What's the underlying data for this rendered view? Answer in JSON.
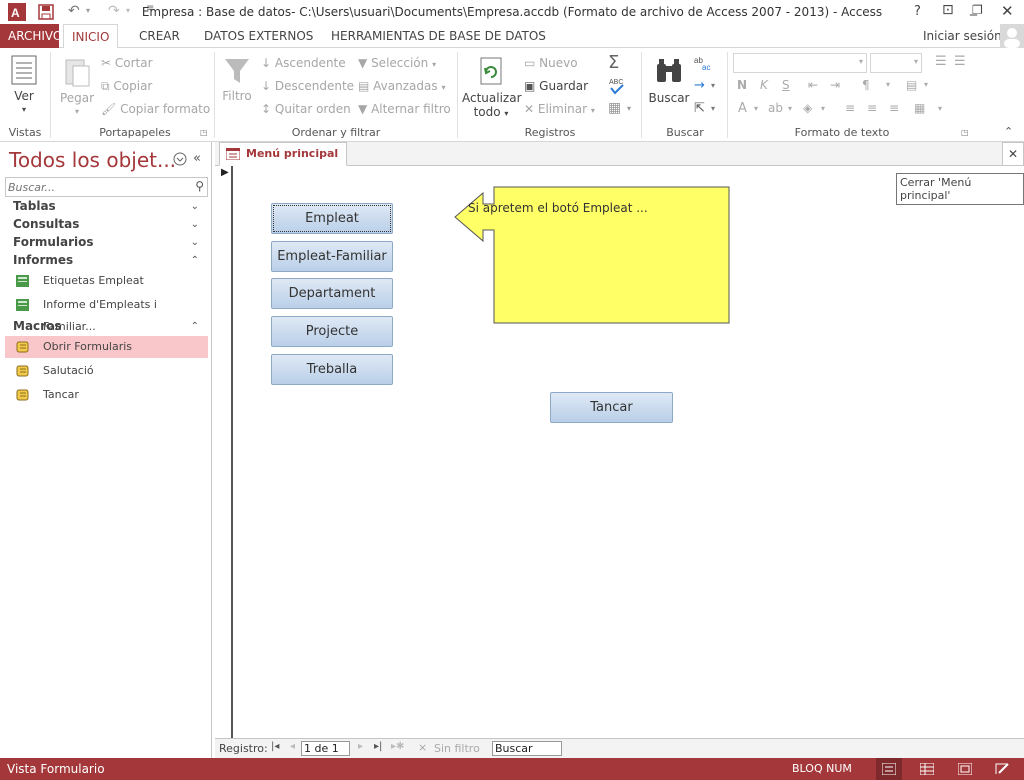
{
  "window": {
    "title": "Empresa : Base de datos- C:\\Users\\usuari\\Documents\\Empresa.accdb (Formato de archivo de Access 2007 - 2013) - Access",
    "help": "?",
    "app_icon": "access-logo"
  },
  "ribbon_tabs": {
    "file": "ARCHIVO",
    "home": "INICIO",
    "create": "CREAR",
    "external": "DATOS EXTERNOS",
    "tools": "HERRAMIENTAS DE BASE DE DATOS",
    "signin": "Iniciar sesión"
  },
  "ribbon": {
    "views": {
      "view": "Ver",
      "label": "Vistas"
    },
    "clipboard": {
      "paste": "Pegar",
      "cut": "Cortar",
      "copy": "Copiar",
      "format_painter": "Copiar formato",
      "label": "Portapapeles"
    },
    "sort": {
      "filter": "Filtro",
      "asc": "Ascendente",
      "desc": "Descendente",
      "remove_sort": "Quitar orden",
      "selection": "Selección",
      "advanced": "Avanzadas",
      "toggle_filter": "Alternar filtro",
      "label": "Ordenar y filtrar"
    },
    "records": {
      "refresh": "Actualizar",
      "refresh2": "todo",
      "new": "Nuevo",
      "save": "Guardar",
      "delete": "Eliminar",
      "label": "Registros"
    },
    "find": {
      "find": "Buscar",
      "label": "Buscar"
    },
    "text": {
      "bold": "N",
      "italic": "K",
      "underline": "S",
      "label": "Formato de texto"
    }
  },
  "nav": {
    "header": "Todos los objet...",
    "search_placeholder": "Buscar...",
    "sections": {
      "tables": "Tablas",
      "queries": "Consultas",
      "forms": "Formularios",
      "reports": "Informes",
      "macros": "Macros"
    },
    "reports": [
      "Etiquetas Empleat",
      "Informe d'Empleats i Familiar..."
    ],
    "macros": [
      "Obrir Formularis",
      "Salutació",
      "Tancar"
    ]
  },
  "document": {
    "tab": "Menú principal",
    "close_tooltip": "Cerrar 'Menú principal'",
    "buttons": {
      "empleat": "Empleat",
      "empleat_familiar": "Empleat-Familiar",
      "departament": "Departament",
      "projecte": "Projecte",
      "treballa": "Treballa",
      "tancar": "Tancar"
    },
    "callout": "Si apretem el botó Empleat ...",
    "callout_color": "#ffff66"
  },
  "recnav": {
    "label": "Registro:",
    "position": "1 de 1",
    "nofilter": "Sin filtro",
    "search": "Buscar"
  },
  "status": {
    "left": "Vista Formulario",
    "numlock": "BLOQ NUM"
  },
  "colors": {
    "accent": "#a4373a",
    "selected": "#f9c7c9"
  }
}
